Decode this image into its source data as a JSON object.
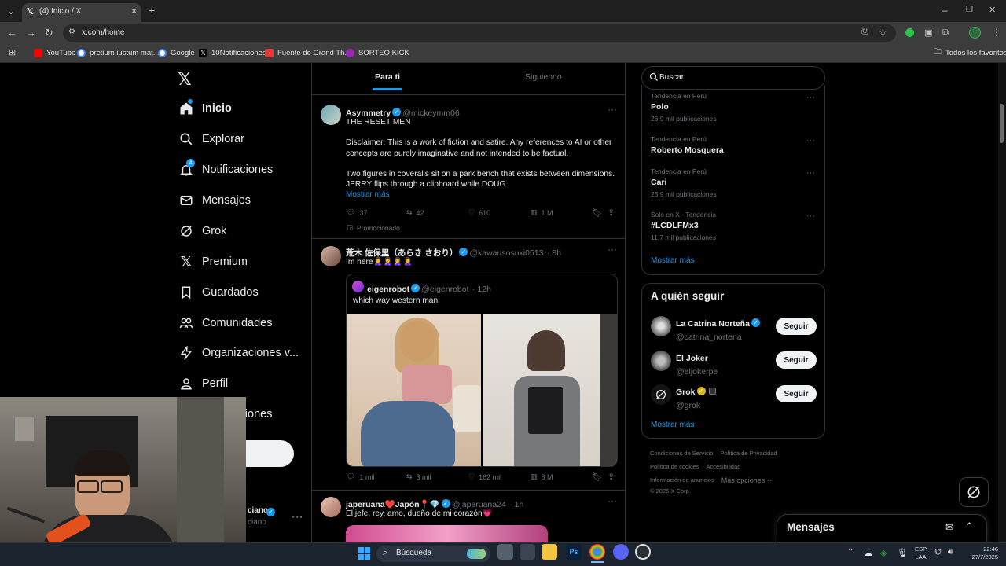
{
  "browser": {
    "tab_title": "(4) Inicio / X",
    "url": "x.com/home",
    "bookmarks": [
      {
        "label": "YouTube",
        "color": "#ff0000"
      },
      {
        "label": "pretium iustum mat...",
        "color": "#4285f4"
      },
      {
        "label": "Google",
        "color": "#4285f4"
      },
      {
        "label": "10Notificaciones",
        "color": "#000000"
      },
      {
        "label": "Fuente de Grand Th...",
        "color": "#e53935"
      },
      {
        "label": "SORTEO KICK",
        "color": "#9c27b0"
      }
    ],
    "all_bookmarks": "Todos los favoritos"
  },
  "nav": {
    "items": [
      {
        "label": "Inicio",
        "icon": "home-icon",
        "active": true
      },
      {
        "label": "Explorar",
        "icon": "search-icon"
      },
      {
        "label": "Notificaciones",
        "icon": "bell-icon",
        "badge": "4"
      },
      {
        "label": "Mensajes",
        "icon": "mail-icon"
      },
      {
        "label": "Grok",
        "icon": "grok-icon"
      },
      {
        "label": "Premium",
        "icon": "x-logo-icon"
      },
      {
        "label": "Guardados",
        "icon": "bookmark-icon"
      },
      {
        "label": "Comunidades",
        "icon": "people-icon"
      },
      {
        "label": "Organizaciones v...",
        "icon": "lightning-icon"
      },
      {
        "label": "Perfil",
        "icon": "person-icon"
      },
      {
        "label": "Más opciones",
        "icon": "more-icon"
      }
    ],
    "account_partial": "ciano",
    "account_handle_partial": "ciano"
  },
  "feed": {
    "tabs": [
      {
        "label": "Para ti",
        "active": true
      },
      {
        "label": "Siguiendo",
        "active": false
      }
    ],
    "tweets": [
      {
        "name": "Asymmetry",
        "handle": "@mickeymm06",
        "time": "",
        "text_lines": [
          "THE RESET MEN",
          "",
          "Disclaimer: This is a work of fiction and satire. Any references to AI or other concepts are purely imaginative and not intended to be factual.",
          "",
          "Two figures in coveralls sit on a park bench that exists between dimensions. JERRY flips through a clipboard while DOUG"
        ],
        "show_more": "Mostrar más",
        "replies": "37",
        "reposts": "42",
        "likes": "610",
        "views": "1 M",
        "promoted": "Promocionado"
      },
      {
        "name": "荒木 佐保里（あらき さおり）",
        "handle": "@kawausosuki0513",
        "time": "· 8h",
        "text": "Im here🙎‍♀️🙎‍♀️🙎‍♀️🙎‍♀️",
        "quote": {
          "name": "eigenrobot",
          "handle": "@eigenrobot",
          "time": "· 12h",
          "text": "which way western man"
        },
        "replies": "1 mil",
        "reposts": "3 mil",
        "likes": "162 mil",
        "views": "8 M"
      },
      {
        "name": "japeruana❤️Japón📍💎",
        "handle": "@japeruana24",
        "time": "· 1h",
        "text": "El jefe, rey, amo, dueño de mi corazón💗"
      }
    ]
  },
  "sidebar": {
    "search_placeholder": "Buscar",
    "trends": [
      {
        "meta": "Tendencia en Perú",
        "name": "Polo",
        "count": "26,9 mil publicaciones"
      },
      {
        "meta": "Tendencia en Perú",
        "name": "Roberto Mosquera",
        "count": ""
      },
      {
        "meta": "Tendencia en Perú",
        "name": "Cari",
        "count": "25,9 mil publicaciones"
      },
      {
        "meta": "Solo en X · Tendencia",
        "name": "#LCDLFMx3",
        "count": "11,7 mil publicaciones"
      }
    ],
    "trends_more": "Mostrar más",
    "who_to_follow": {
      "title": "A quién seguir",
      "users": [
        {
          "name": "La Catrina Norteña",
          "handle": "@catrina_nortena",
          "button": "Seguir"
        },
        {
          "name": "El Joker",
          "handle": "@eljokerpe",
          "button": "Seguir"
        },
        {
          "name": "Grok",
          "handle": "@grok",
          "button": "Seguir"
        }
      ],
      "more": "Mostrar más"
    },
    "footer": {
      "line1": [
        "Condiciones de Servicio",
        "Política de Privacidad"
      ],
      "line2": [
        "Política de cookies",
        "Accesibilidad"
      ],
      "line3": [
        "Información de anuncios",
        "Más opciones ···"
      ],
      "copyright": "© 2025 X Corp."
    }
  },
  "messages_drawer": {
    "title": "Mensajes"
  },
  "taskbar": {
    "search_label": "Búsqueda",
    "lang_top": "ESP",
    "lang_bottom": "LAA",
    "time": "22:46",
    "date": "27/7/2025"
  },
  "colors": {
    "accent": "#1d9bf0",
    "bg": "#000000",
    "border": "#2f3336"
  }
}
